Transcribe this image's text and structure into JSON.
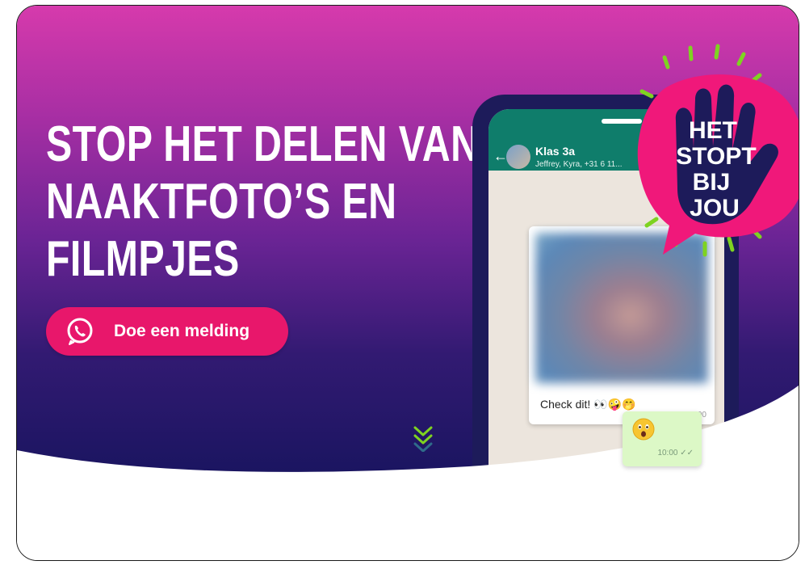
{
  "hero": {
    "headline_line1": "STOP HET DELEN VAN",
    "headline_line2": "NAAKTFOTO’S EN",
    "headline_line3": "FILMPJES",
    "cta_label": "Doe een melding",
    "cta_icon": "whatsapp-icon",
    "scroll_icon": "double-chevron-down-icon"
  },
  "phone": {
    "chat_name": "Klas 3a",
    "chat_members": "Jeffrey, Kyra, +31 6 11...",
    "incoming_message": "Check dit! 👀🤪🤭",
    "incoming_time": "10:00",
    "outgoing_emoji": "astonished-face-icon",
    "outgoing_time": "10:00 ✓✓"
  },
  "badge": {
    "line1": "HET",
    "line2": "STOPT",
    "line3": "BIJ",
    "line4": "JOU"
  },
  "colors": {
    "accent_pink": "#e8176b",
    "whatsapp_green": "#0f7d6b",
    "badge_navy": "#1d1b5a",
    "spark_green": "#7ed321"
  }
}
